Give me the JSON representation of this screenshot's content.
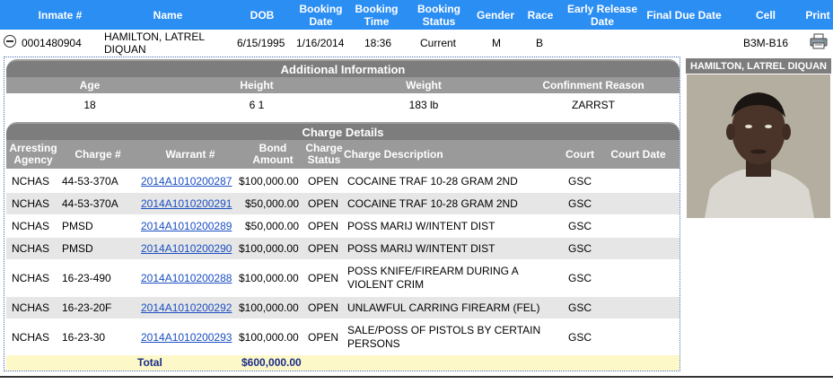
{
  "header": {
    "inmate_no": "Inmate #",
    "name": "Name",
    "dob": "DOB",
    "booking_date": "Booking Date",
    "booking_time": "Booking Time",
    "booking_status": "Booking Status",
    "gender": "Gender",
    "race": "Race",
    "early_release_date": "Early Release Date",
    "final_due_date": "Final Due Date",
    "cell": "Cell",
    "print": "Print"
  },
  "inmate": {
    "inmate_no": "0001480904",
    "name": "HAMILTON, LATREL DIQUAN",
    "dob": "6/15/1995",
    "booking_date": "1/16/2014",
    "booking_time": "18:36",
    "booking_status": "Current",
    "gender": "M",
    "race": "B",
    "early_release_date": "",
    "final_due_date": "",
    "cell": "B3M-B16"
  },
  "additional_info": {
    "title": "Additional Information",
    "headers": {
      "age": "Age",
      "height": "Height",
      "weight": "Weight",
      "confinement_reason": "Confinment Reason"
    },
    "values": {
      "age": "18",
      "height": "6 1",
      "weight": "183 lb",
      "confinement_reason": "ZARRST"
    }
  },
  "charge_details": {
    "title": "Charge Details",
    "headers": {
      "arresting_agency": "Arresting Agency",
      "charge_no": "Charge #",
      "warrant_no": "Warrant #",
      "bond_amount": "Bond Amount",
      "charge_status": "Charge Status",
      "charge_description": "Charge Description",
      "court": "Court",
      "court_date": "Court Date"
    },
    "rows": [
      {
        "agency": "NCHAS",
        "charge": "44-53-370A",
        "warrant": "2014A1010200287",
        "bond": "$100,000.00",
        "status": "OPEN",
        "description": "COCAINE TRAF 10-28 GRAM 2ND",
        "court": "GSC",
        "court_date": ""
      },
      {
        "agency": "NCHAS",
        "charge": "44-53-370A",
        "warrant": "2014A1010200291",
        "bond": "$50,000.00",
        "status": "OPEN",
        "description": "COCAINE TRAF 10-28 GRAM 2ND",
        "court": "GSC",
        "court_date": ""
      },
      {
        "agency": "NCHAS",
        "charge": "PMSD",
        "warrant": "2014A1010200289",
        "bond": "$50,000.00",
        "status": "OPEN",
        "description": "POSS MARIJ W/INTENT DIST",
        "court": "GSC",
        "court_date": ""
      },
      {
        "agency": "NCHAS",
        "charge": "PMSD",
        "warrant": "2014A1010200290",
        "bond": "$100,000.00",
        "status": "OPEN",
        "description": "POSS MARIJ W/INTENT DIST",
        "court": "GSC",
        "court_date": ""
      },
      {
        "agency": "NCHAS",
        "charge": "16-23-490",
        "warrant": "2014A1010200288",
        "bond": "$100,000.00",
        "status": "OPEN",
        "description": "POSS KNIFE/FIREARM DURING A VIOLENT CRIM",
        "court": "GSC",
        "court_date": ""
      },
      {
        "agency": "NCHAS",
        "charge": "16-23-20F",
        "warrant": "2014A1010200292",
        "bond": "$100,000.00",
        "status": "OPEN",
        "description": "UNLAWFUL CARRING FIREARM (FEL)",
        "court": "GSC",
        "court_date": ""
      },
      {
        "agency": "NCHAS",
        "charge": "16-23-30",
        "warrant": "2014A1010200293",
        "bond": "$100,000.00",
        "status": "OPEN",
        "description": "SALE/POSS OF PISTOLS BY CERTAIN PERSONS",
        "court": "GSC",
        "court_date": ""
      }
    ],
    "total_label": "Total",
    "total_amount": "$600,000.00"
  },
  "photo": {
    "caption": "HAMILTON, LATREL DIQUAN"
  },
  "icons": {
    "collapse": "minus-circle-icon",
    "print": "printer-icon"
  },
  "colors": {
    "header_blue": "#2b8ef3",
    "section_grey": "#7d7d7d",
    "link_blue": "#1b4fc2",
    "total_yellow": "#fdf8c8",
    "total_text": "#1a2d8a"
  }
}
